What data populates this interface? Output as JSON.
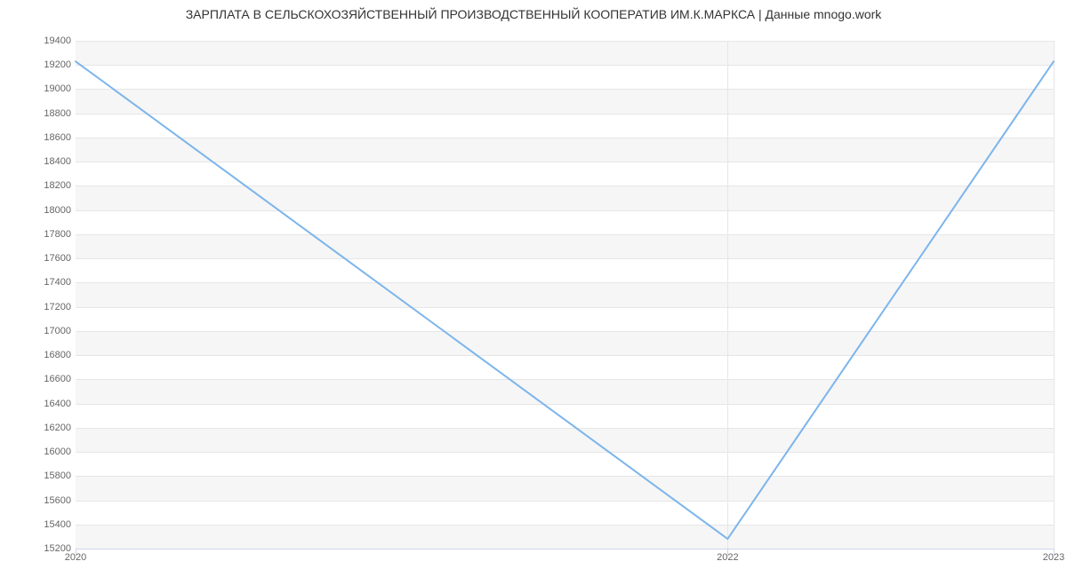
{
  "chart_data": {
    "type": "line",
    "title": "ЗАРПЛАТА В СЕЛЬСКОХОЗЯЙСТВЕННЫЙ ПРОИЗВОДСТВЕННЫЙ КООПЕРАТИВ ИМ.К.МАРКСА | Данные mnogo.work",
    "x": [
      2020,
      2022,
      2023
    ],
    "values": [
      19230,
      15280,
      19230
    ],
    "y_ticks": [
      15200,
      15400,
      15600,
      15800,
      16000,
      16200,
      16400,
      16600,
      16800,
      17000,
      17200,
      17400,
      17600,
      17800,
      18000,
      18200,
      18400,
      18600,
      18800,
      19000,
      19200,
      19400
    ],
    "x_ticks": [
      2020,
      2022,
      2023
    ],
    "ylim": [
      15200,
      19400
    ],
    "xlim": [
      2020,
      2023
    ],
    "xlabel": "",
    "ylabel": "",
    "colors": {
      "series": "#7cb5ec"
    }
  }
}
